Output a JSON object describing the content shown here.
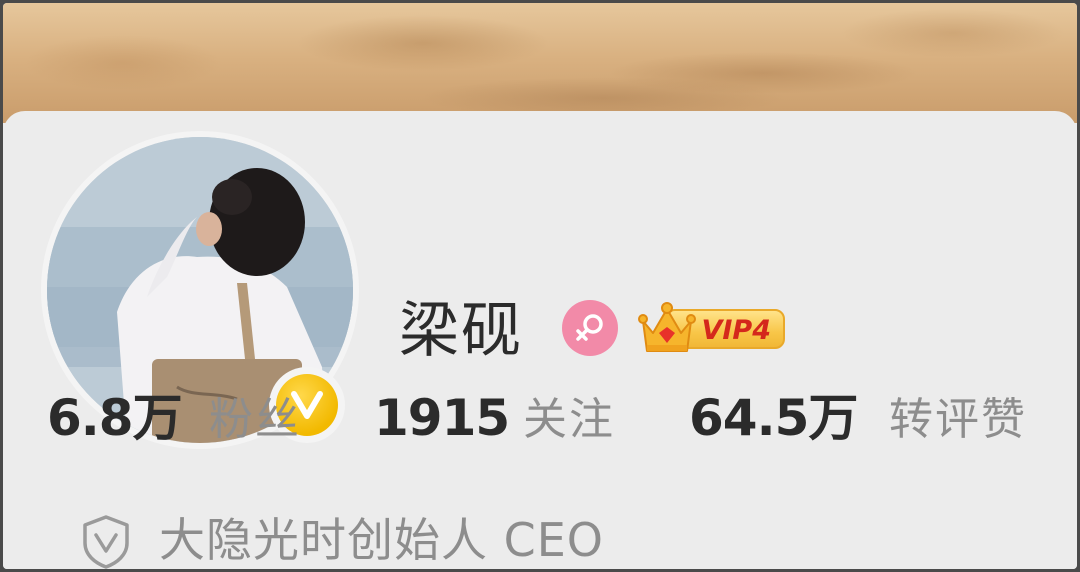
{
  "profile": {
    "name": "梁砚",
    "gender_icon": "female-icon",
    "verified_icon": "verified-v-icon",
    "vip_label": "VIP4",
    "vip_icon": "crown-icon"
  },
  "stats": [
    {
      "value": "6.8万",
      "label": "粉丝"
    },
    {
      "value": "1915",
      "label": "关注"
    },
    {
      "value": "64.5万",
      "label": "转评赞"
    }
  ],
  "verification": {
    "icon": "shield-icon",
    "text": "大隐光时创始人 CEO"
  },
  "colors": {
    "verified_badge": "#f2b900",
    "gender_badge": "#f28aa8",
    "vip_text": "#d4281c"
  }
}
